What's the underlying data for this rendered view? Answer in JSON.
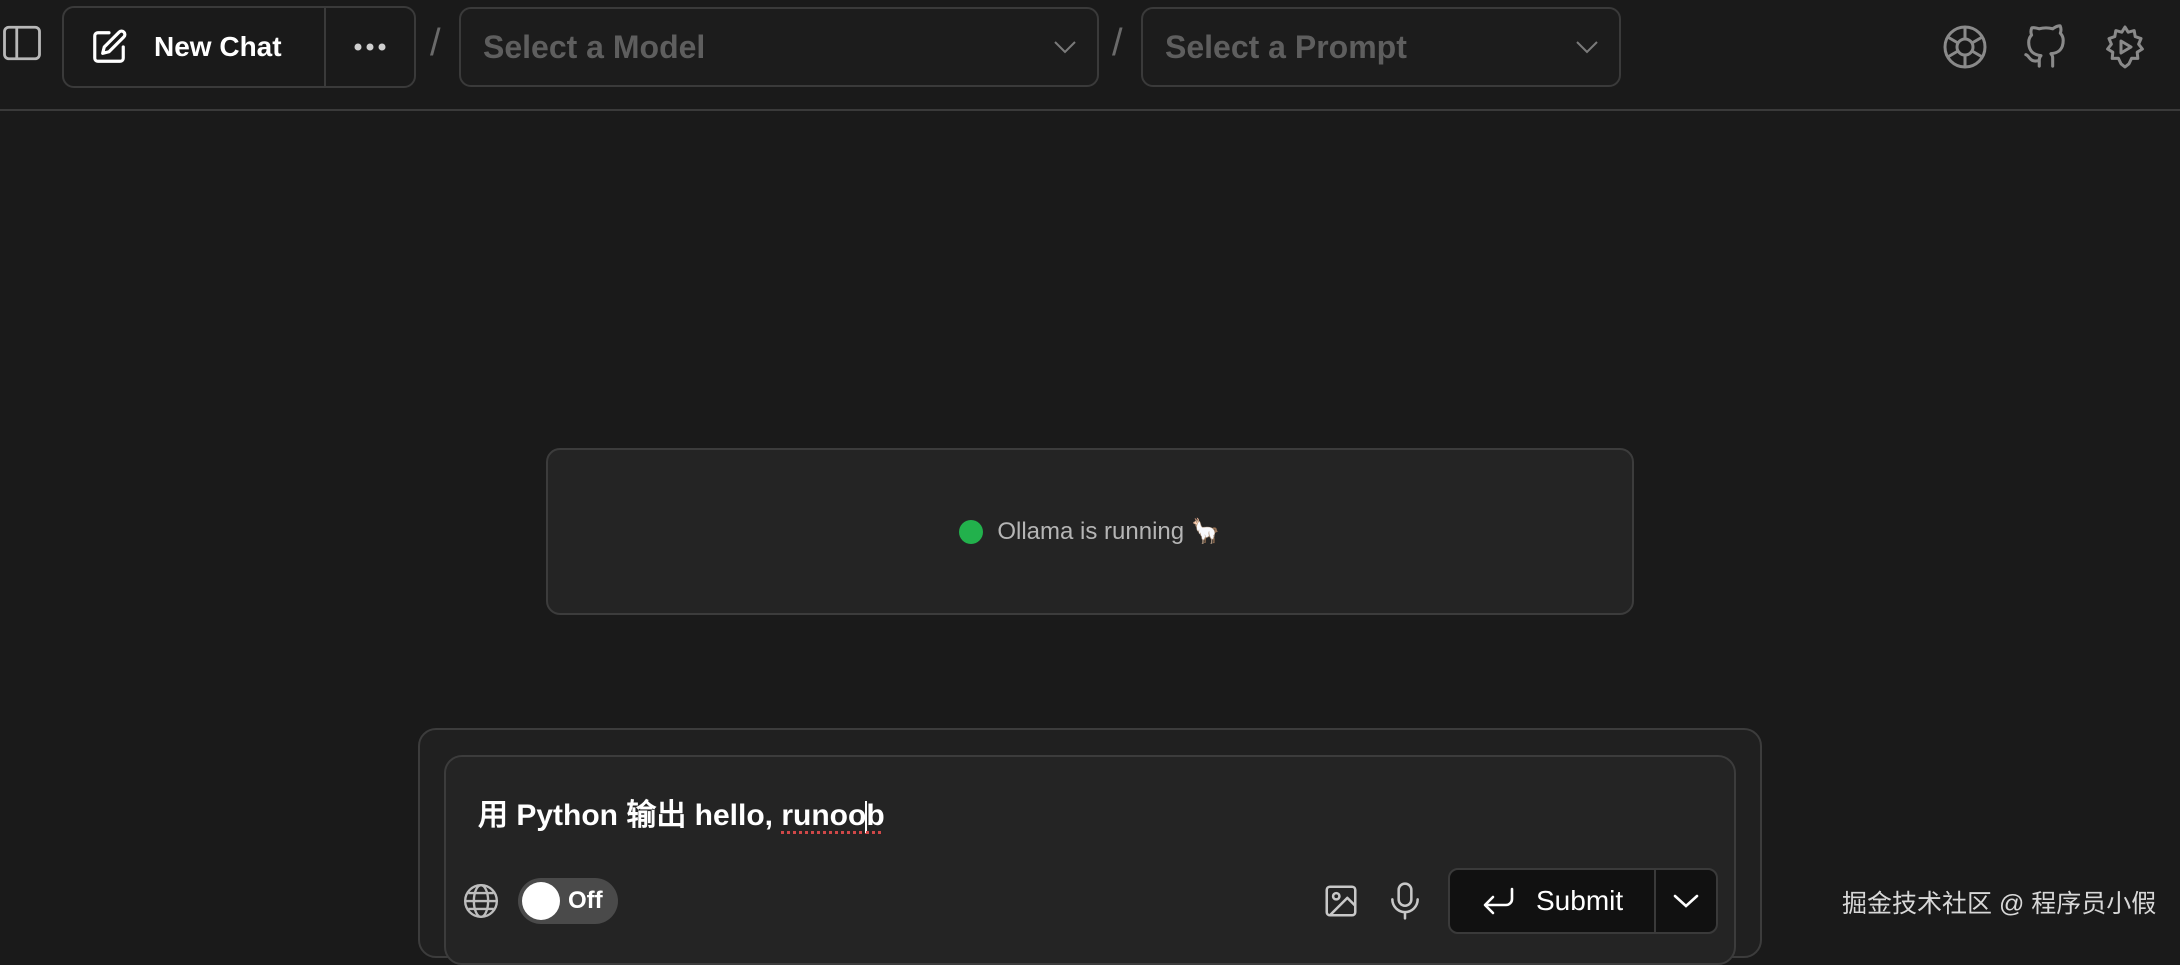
{
  "header": {
    "new_chat_label": "New Chat",
    "model_select_placeholder": "Select a Model",
    "prompt_select_placeholder": "Select a Prompt",
    "separator": "/",
    "icons": [
      "sidebar-toggle-icon",
      "edit-icon",
      "more-icon",
      "chevron-down-icon",
      "openai-icon",
      "github-icon",
      "settings-gear-icon"
    ]
  },
  "status": {
    "text": "Ollama is running 🦙",
    "color": "#22b14c"
  },
  "composer": {
    "prompt_before_caret": "用 Python 输出 hello, ",
    "prompt_underlined_a": "runoo",
    "prompt_underlined_b": "b",
    "web_search_toggle": "Off",
    "submit_label": "Submit",
    "icons": [
      "globe-icon",
      "image-icon",
      "microphone-icon",
      "enter-icon",
      "chevron-down-icon"
    ]
  },
  "watermark": "掘金技术社区 @ 程序员小假",
  "colors": {
    "background": "#1a1a1a",
    "panel": "#242424",
    "border": "#3c3c3c",
    "status_green": "#22b14c"
  }
}
